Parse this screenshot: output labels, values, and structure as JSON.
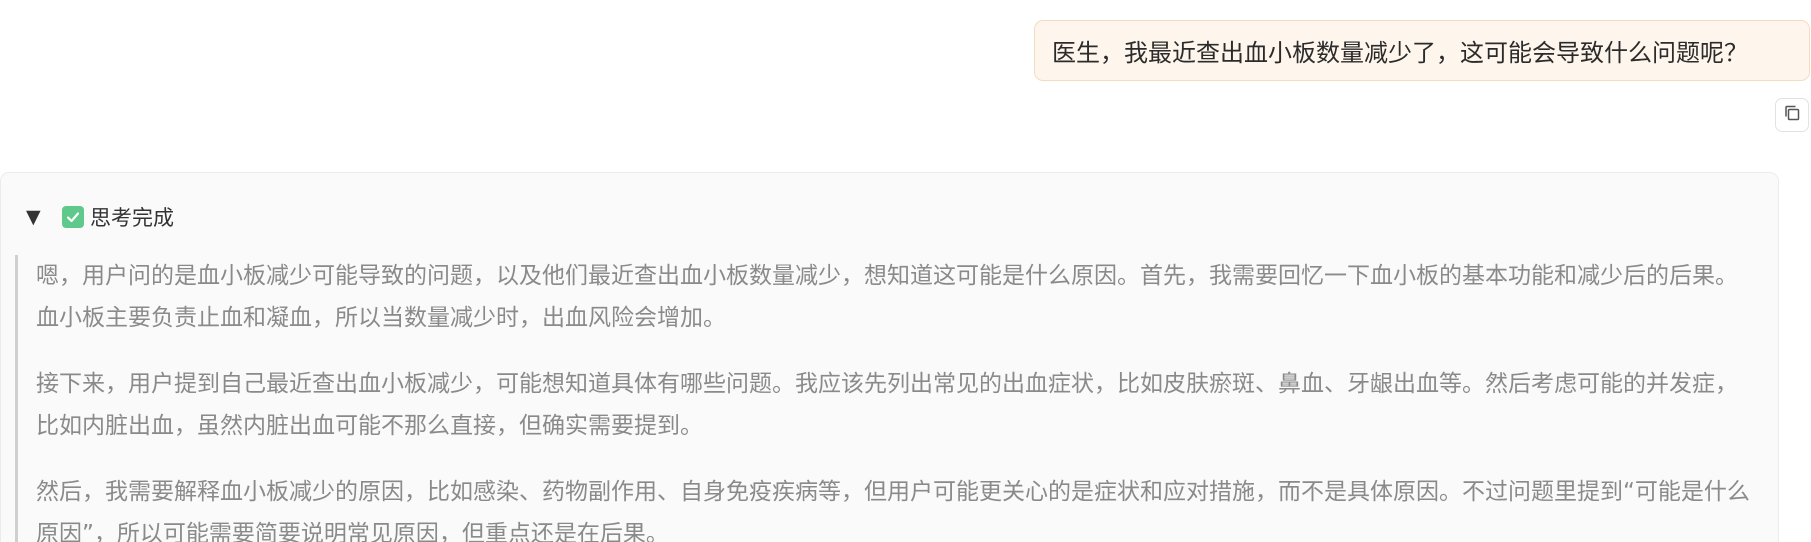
{
  "user_message": {
    "text": "医生，我最近查出血小板数量减少了，这可能会导致什么问题呢？"
  },
  "copy_button": {
    "icon": "copy-icon"
  },
  "thinking": {
    "toggle_icon": "▼",
    "status_icon": "check-icon",
    "status_color": "#5fc98b",
    "label": "思考完成",
    "paragraphs": [
      "嗯，用户问的是血小板减少可能导致的问题，以及他们最近查出血小板数量减少，想知道这可能是什么原因。首先，我需要回忆一下血小板的基本功能和减少后的后果。血小板主要负责止血和凝血，所以当数量减少时，出血风险会增加。",
      "接下来，用户提到自己最近查出血小板减少，可能想知道具体有哪些问题。我应该先列出常见的出血症状，比如皮肤瘀斑、鼻血、牙龈出血等。然后考虑可能的并发症，比如内脏出血，虽然内脏出血可能不那么直接，但确实需要提到。",
      "然后，我需要解释血小板减少的原因，比如感染、药物副作用、自身免疫疾病等，但用户可能更关心的是症状和应对措施，而不是具体原因。不过问题里提到“可能是什么原因”，所以可能需要简要说明常见原因，但重点还是在后果。"
    ]
  },
  "colors": {
    "user_bubble_bg": "#fef6ec",
    "user_bubble_border": "#f4dcc0",
    "panel_bg": "#fafafa",
    "thinking_text": "#8a8a8a"
  }
}
